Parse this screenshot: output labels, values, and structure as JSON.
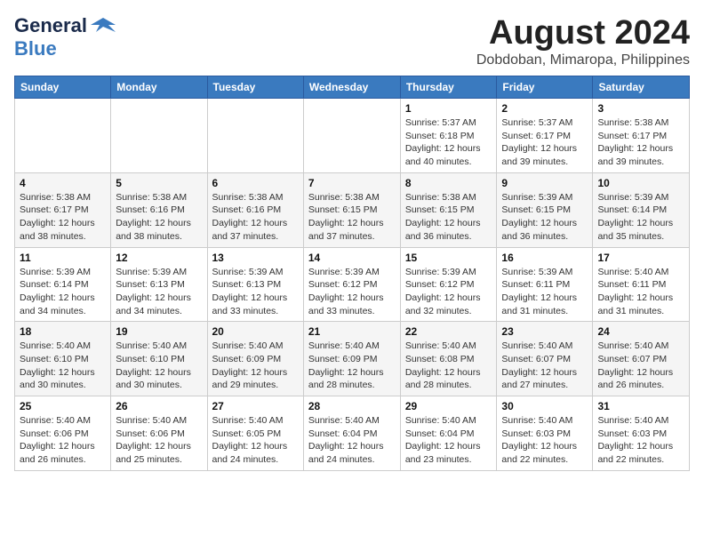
{
  "logo": {
    "line1": "General",
    "line2": "Blue",
    "icon_unicode": "⚑"
  },
  "title": "August 2024",
  "subtitle": "Dobdoban, Mimaropa, Philippines",
  "weekdays": [
    "Sunday",
    "Monday",
    "Tuesday",
    "Wednesday",
    "Thursday",
    "Friday",
    "Saturday"
  ],
  "weeks": [
    [
      {
        "day": "",
        "info": ""
      },
      {
        "day": "",
        "info": ""
      },
      {
        "day": "",
        "info": ""
      },
      {
        "day": "",
        "info": ""
      },
      {
        "day": "1",
        "info": "Sunrise: 5:37 AM\nSunset: 6:18 PM\nDaylight: 12 hours\nand 40 minutes."
      },
      {
        "day": "2",
        "info": "Sunrise: 5:37 AM\nSunset: 6:17 PM\nDaylight: 12 hours\nand 39 minutes."
      },
      {
        "day": "3",
        "info": "Sunrise: 5:38 AM\nSunset: 6:17 PM\nDaylight: 12 hours\nand 39 minutes."
      }
    ],
    [
      {
        "day": "4",
        "info": "Sunrise: 5:38 AM\nSunset: 6:17 PM\nDaylight: 12 hours\nand 38 minutes."
      },
      {
        "day": "5",
        "info": "Sunrise: 5:38 AM\nSunset: 6:16 PM\nDaylight: 12 hours\nand 38 minutes."
      },
      {
        "day": "6",
        "info": "Sunrise: 5:38 AM\nSunset: 6:16 PM\nDaylight: 12 hours\nand 37 minutes."
      },
      {
        "day": "7",
        "info": "Sunrise: 5:38 AM\nSunset: 6:15 PM\nDaylight: 12 hours\nand 37 minutes."
      },
      {
        "day": "8",
        "info": "Sunrise: 5:38 AM\nSunset: 6:15 PM\nDaylight: 12 hours\nand 36 minutes."
      },
      {
        "day": "9",
        "info": "Sunrise: 5:39 AM\nSunset: 6:15 PM\nDaylight: 12 hours\nand 36 minutes."
      },
      {
        "day": "10",
        "info": "Sunrise: 5:39 AM\nSunset: 6:14 PM\nDaylight: 12 hours\nand 35 minutes."
      }
    ],
    [
      {
        "day": "11",
        "info": "Sunrise: 5:39 AM\nSunset: 6:14 PM\nDaylight: 12 hours\nand 34 minutes."
      },
      {
        "day": "12",
        "info": "Sunrise: 5:39 AM\nSunset: 6:13 PM\nDaylight: 12 hours\nand 34 minutes."
      },
      {
        "day": "13",
        "info": "Sunrise: 5:39 AM\nSunset: 6:13 PM\nDaylight: 12 hours\nand 33 minutes."
      },
      {
        "day": "14",
        "info": "Sunrise: 5:39 AM\nSunset: 6:12 PM\nDaylight: 12 hours\nand 33 minutes."
      },
      {
        "day": "15",
        "info": "Sunrise: 5:39 AM\nSunset: 6:12 PM\nDaylight: 12 hours\nand 32 minutes."
      },
      {
        "day": "16",
        "info": "Sunrise: 5:39 AM\nSunset: 6:11 PM\nDaylight: 12 hours\nand 31 minutes."
      },
      {
        "day": "17",
        "info": "Sunrise: 5:40 AM\nSunset: 6:11 PM\nDaylight: 12 hours\nand 31 minutes."
      }
    ],
    [
      {
        "day": "18",
        "info": "Sunrise: 5:40 AM\nSunset: 6:10 PM\nDaylight: 12 hours\nand 30 minutes."
      },
      {
        "day": "19",
        "info": "Sunrise: 5:40 AM\nSunset: 6:10 PM\nDaylight: 12 hours\nand 30 minutes."
      },
      {
        "day": "20",
        "info": "Sunrise: 5:40 AM\nSunset: 6:09 PM\nDaylight: 12 hours\nand 29 minutes."
      },
      {
        "day": "21",
        "info": "Sunrise: 5:40 AM\nSunset: 6:09 PM\nDaylight: 12 hours\nand 28 minutes."
      },
      {
        "day": "22",
        "info": "Sunrise: 5:40 AM\nSunset: 6:08 PM\nDaylight: 12 hours\nand 28 minutes."
      },
      {
        "day": "23",
        "info": "Sunrise: 5:40 AM\nSunset: 6:07 PM\nDaylight: 12 hours\nand 27 minutes."
      },
      {
        "day": "24",
        "info": "Sunrise: 5:40 AM\nSunset: 6:07 PM\nDaylight: 12 hours\nand 26 minutes."
      }
    ],
    [
      {
        "day": "25",
        "info": "Sunrise: 5:40 AM\nSunset: 6:06 PM\nDaylight: 12 hours\nand 26 minutes."
      },
      {
        "day": "26",
        "info": "Sunrise: 5:40 AM\nSunset: 6:06 PM\nDaylight: 12 hours\nand 25 minutes."
      },
      {
        "day": "27",
        "info": "Sunrise: 5:40 AM\nSunset: 6:05 PM\nDaylight: 12 hours\nand 24 minutes."
      },
      {
        "day": "28",
        "info": "Sunrise: 5:40 AM\nSunset: 6:04 PM\nDaylight: 12 hours\nand 24 minutes."
      },
      {
        "day": "29",
        "info": "Sunrise: 5:40 AM\nSunset: 6:04 PM\nDaylight: 12 hours\nand 23 minutes."
      },
      {
        "day": "30",
        "info": "Sunrise: 5:40 AM\nSunset: 6:03 PM\nDaylight: 12 hours\nand 22 minutes."
      },
      {
        "day": "31",
        "info": "Sunrise: 5:40 AM\nSunset: 6:03 PM\nDaylight: 12 hours\nand 22 minutes."
      }
    ]
  ]
}
